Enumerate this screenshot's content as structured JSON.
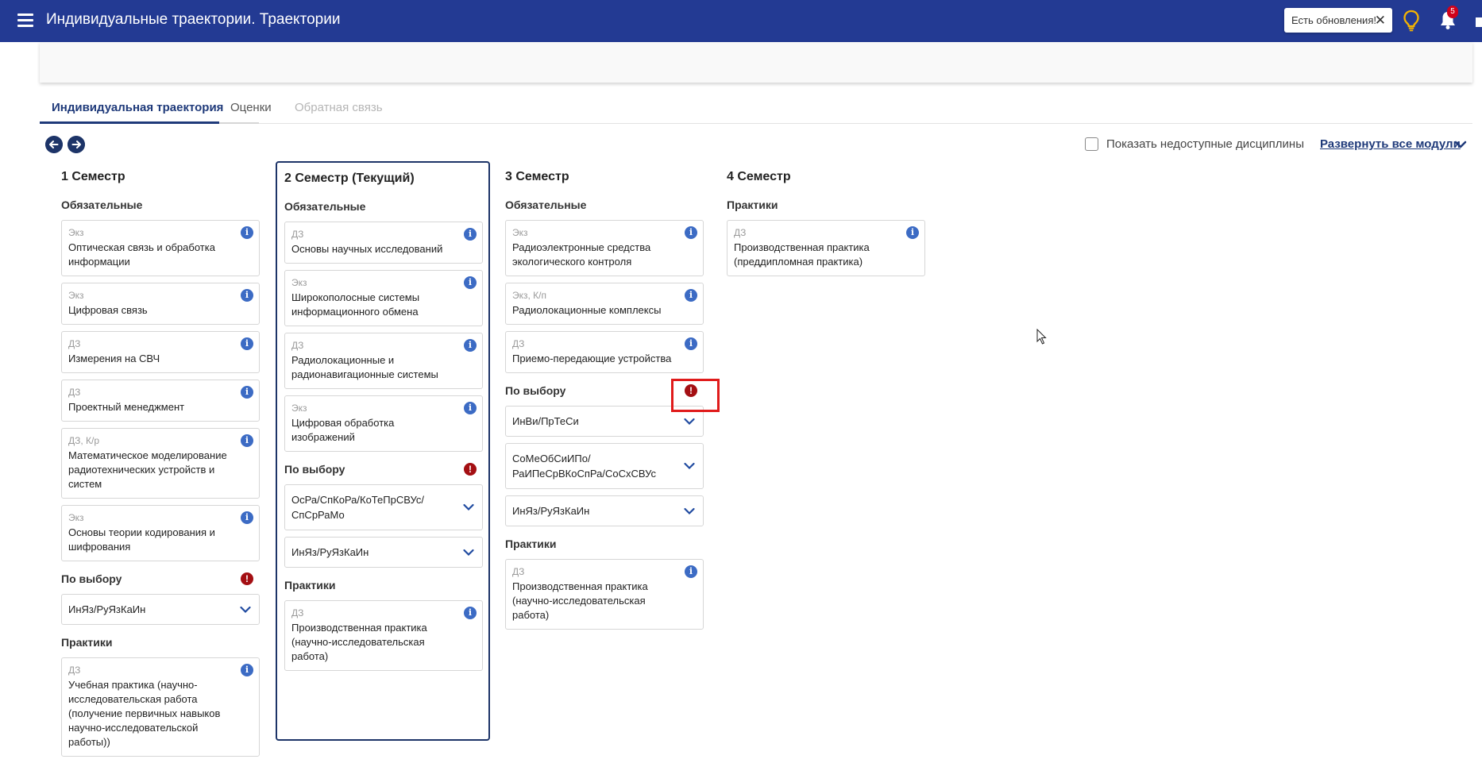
{
  "app": {
    "title": "Индивидуальные траектории. Траектории",
    "toast_text": "Есть обновления!",
    "toast_close": "✕",
    "notifications_count": "5",
    "accent_color": "#233a93"
  },
  "tabs": [
    {
      "label": "Индивидуальная траектория",
      "state": "active"
    },
    {
      "label": "Оценки",
      "state": "normal"
    },
    {
      "label": "Обратная связь",
      "state": "disabled"
    }
  ],
  "toolbar": {
    "prev_icon": "arrow-left-icon",
    "next_icon": "arrow-right-icon",
    "show_unavailable_label": "Показать недоступные дисциплины",
    "expand_all_label": "Развернуть все модули"
  },
  "semesters": [
    {
      "title": "1 Семестр",
      "required_title": "Обязательные",
      "required": [
        {
          "type": "Экз",
          "name": "Оптическая связь и обработка информации"
        },
        {
          "type": "Экз",
          "name": "Цифровая связь"
        },
        {
          "type": "ДЗ",
          "name": "Измерения на СВЧ"
        },
        {
          "type": "ДЗ",
          "name": "Проектный менеджмент"
        },
        {
          "type": "ДЗ, К/р",
          "name": "Математическое моделирование радиотехнических устройств и систем"
        },
        {
          "type": "Экз",
          "name": "Основы теории кодирования и шифрования"
        }
      ],
      "elective_title": "По выбору",
      "electives": [
        "ИнЯз/РуЯзКаИн"
      ],
      "practice_title": "Практики",
      "practices": [
        {
          "type": "ДЗ",
          "name": "Учебная практика (научно-исследовательская работа (получение первичных навыков научно-исследовательской работы))"
        }
      ]
    },
    {
      "title": "2 Семестр (Текущий)",
      "required_title": "Обязательные",
      "required": [
        {
          "type": "ДЗ",
          "name": "Основы научных исследований"
        },
        {
          "type": "Экз",
          "name": "Широкополосные системы информационного обмена"
        },
        {
          "type": "ДЗ",
          "name": "Радиолокационные и радионавигационные системы"
        },
        {
          "type": "Экз",
          "name": "Цифровая обработка изображений"
        }
      ],
      "elective_title": "По выбору",
      "electives": [
        "ОсРа/СпКоРа/КоТеПрСВУс/СпСрРаМо",
        "ИнЯз/РуЯзКаИн"
      ],
      "practice_title": "Практики",
      "practices": [
        {
          "type": "ДЗ",
          "name": "Производственная практика (научно-исследовательская работа)"
        }
      ]
    },
    {
      "title": "3 Семестр",
      "required_title": "Обязательные",
      "required": [
        {
          "type": "Экз",
          "name": "Радиоэлектронные средства экологического контроля"
        },
        {
          "type": "Экз, К/п",
          "name": "Радиолокационные комплексы"
        },
        {
          "type": "ДЗ",
          "name": "Приемо-передающие устройства"
        }
      ],
      "elective_title": "По выбору",
      "electives": [
        "ИнВи/ПрТеСи",
        "СоМеОбСиИПо/РаИПеСрВКоСпРа/СоСхСВУс",
        "ИнЯз/РуЯзКаИн"
      ],
      "practice_title": "Практики",
      "practices": [
        {
          "type": "ДЗ",
          "name": "Производственная практика (научно-исследовательская работа)"
        }
      ]
    },
    {
      "title": "4 Семестр",
      "practice_title": "Практики",
      "practices": [
        {
          "type": "ДЗ",
          "name": "Производственная практика (преддипломная практика)"
        }
      ]
    }
  ]
}
